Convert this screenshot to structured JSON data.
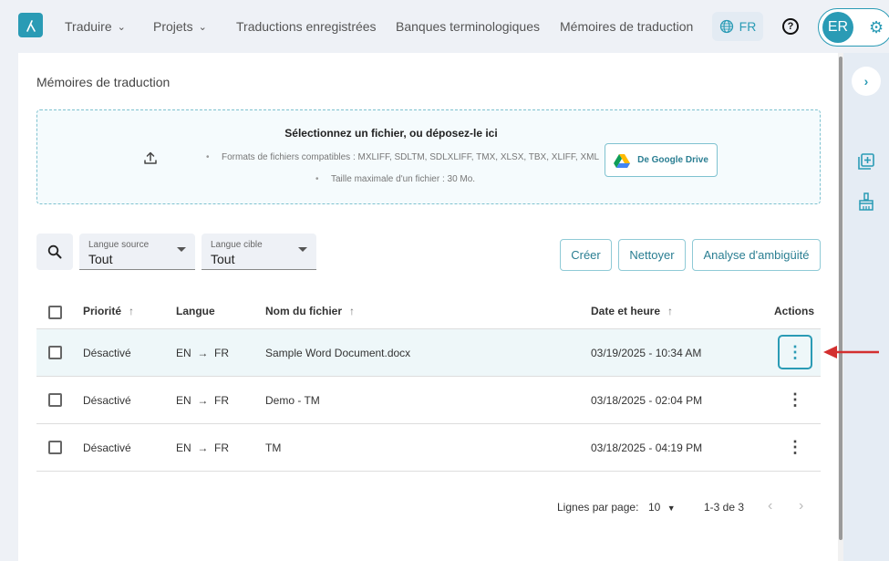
{
  "nav": {
    "items": [
      {
        "label": "Traduire",
        "has_dropdown": true
      },
      {
        "label": "Projets",
        "has_dropdown": true
      },
      {
        "label": "Traductions enregistrées",
        "has_dropdown": false
      },
      {
        "label": "Banques terminologiques",
        "has_dropdown": false
      },
      {
        "label": "Mémoires de traduction",
        "has_dropdown": false
      }
    ],
    "language": "FR",
    "user_initials": "ER"
  },
  "page": {
    "title": "Mémoires de traduction"
  },
  "dropzone": {
    "title": "Sélectionnez un fichier, ou déposez-le ici",
    "formats": "Formats de fichiers compatibles : MXLIFF, SDLTM, SDLXLIFF, TMX, XLSX, TBX, XLIFF, XML",
    "max_size": "Taille maximale d'un fichier : 30 Mo.",
    "gdrive_label": "De Google Drive"
  },
  "filters": {
    "source": {
      "label": "Langue source",
      "value": "Tout"
    },
    "target": {
      "label": "Langue cible",
      "value": "Tout"
    }
  },
  "actions": {
    "create": "Créer",
    "clean": "Nettoyer",
    "ambiguity": "Analyse d'ambigüité"
  },
  "table": {
    "headers": {
      "priority": "Priorité",
      "language": "Langue",
      "filename": "Nom du fichier",
      "datetime": "Date et heure",
      "actions": "Actions"
    },
    "rows": [
      {
        "priority": "Désactivé",
        "src": "EN",
        "tgt": "FR",
        "filename": "Sample Word Document.docx",
        "datetime": "03/19/2025 - 10:34 AM"
      },
      {
        "priority": "Désactivé",
        "src": "EN",
        "tgt": "FR",
        "filename": "Demo - TM",
        "datetime": "03/18/2025 - 02:04 PM"
      },
      {
        "priority": "Désactivé",
        "src": "EN",
        "tgt": "FR",
        "filename": "TM",
        "datetime": "03/18/2025 - 04:19 PM"
      }
    ]
  },
  "pagination": {
    "rows_per_page_label": "Lignes par page:",
    "rows_per_page": "10",
    "range": "1-3 de 3"
  },
  "colors": {
    "accent": "#2a9bb5",
    "annotation": "#d32f2f"
  }
}
